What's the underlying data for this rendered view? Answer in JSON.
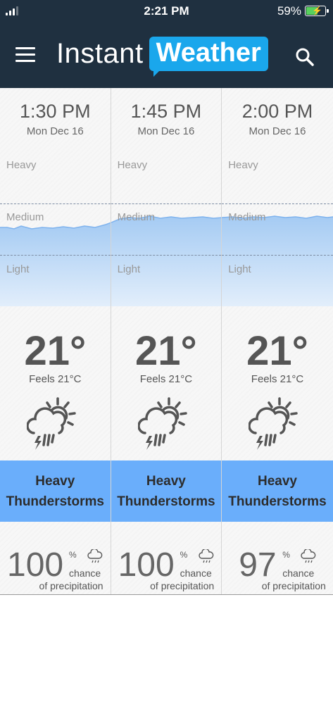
{
  "status_bar": {
    "time": "2:21 PM",
    "battery_percent": "59%",
    "battery_level": 0.59,
    "charging": true
  },
  "header": {
    "logo_word1": "Instant",
    "logo_word2": "Weather",
    "menu_icon": "hamburger-menu-icon",
    "search_icon": "search-icon",
    "background_color": "#1f3040",
    "accent_color": "#1aa7ec"
  },
  "intensity_labels": {
    "heavy": "Heavy",
    "medium": "Medium",
    "light": "Light"
  },
  "columns": [
    {
      "time": "1:30 PM",
      "date": "Mon Dec 16",
      "temperature": "21°",
      "feels_like": "Feels 21°C",
      "condition_line1": "Heavy",
      "condition_line2": "Thunderstorms",
      "condition_icon": "thunderstorm-sun-icon",
      "precip_value": "100",
      "precip_unit": "%",
      "precip_chance": "chance",
      "precip_of": "of precipitation"
    },
    {
      "time": "1:45 PM",
      "date": "Mon Dec 16",
      "temperature": "21°",
      "feels_like": "Feels 21°C",
      "condition_line1": "Heavy",
      "condition_line2": "Thunderstorms",
      "condition_icon": "thunderstorm-sun-icon",
      "precip_value": "100",
      "precip_unit": "%",
      "precip_chance": "chance",
      "precip_of": "of precipitation"
    },
    {
      "time": "2:00 PM",
      "date": "Mon Dec 16",
      "temperature": "21°",
      "feels_like": "Feels 21°C",
      "condition_line1": "Heavy",
      "condition_line2": "Thunderstorms",
      "condition_icon": "thunderstorm-sun-icon",
      "precip_value": "97",
      "precip_unit": "%",
      "precip_chance": "chance",
      "precip_of": "of precipitation"
    }
  ],
  "colors": {
    "condition_band": "#6aaefb",
    "precip_fill": "#a8cdf5"
  }
}
